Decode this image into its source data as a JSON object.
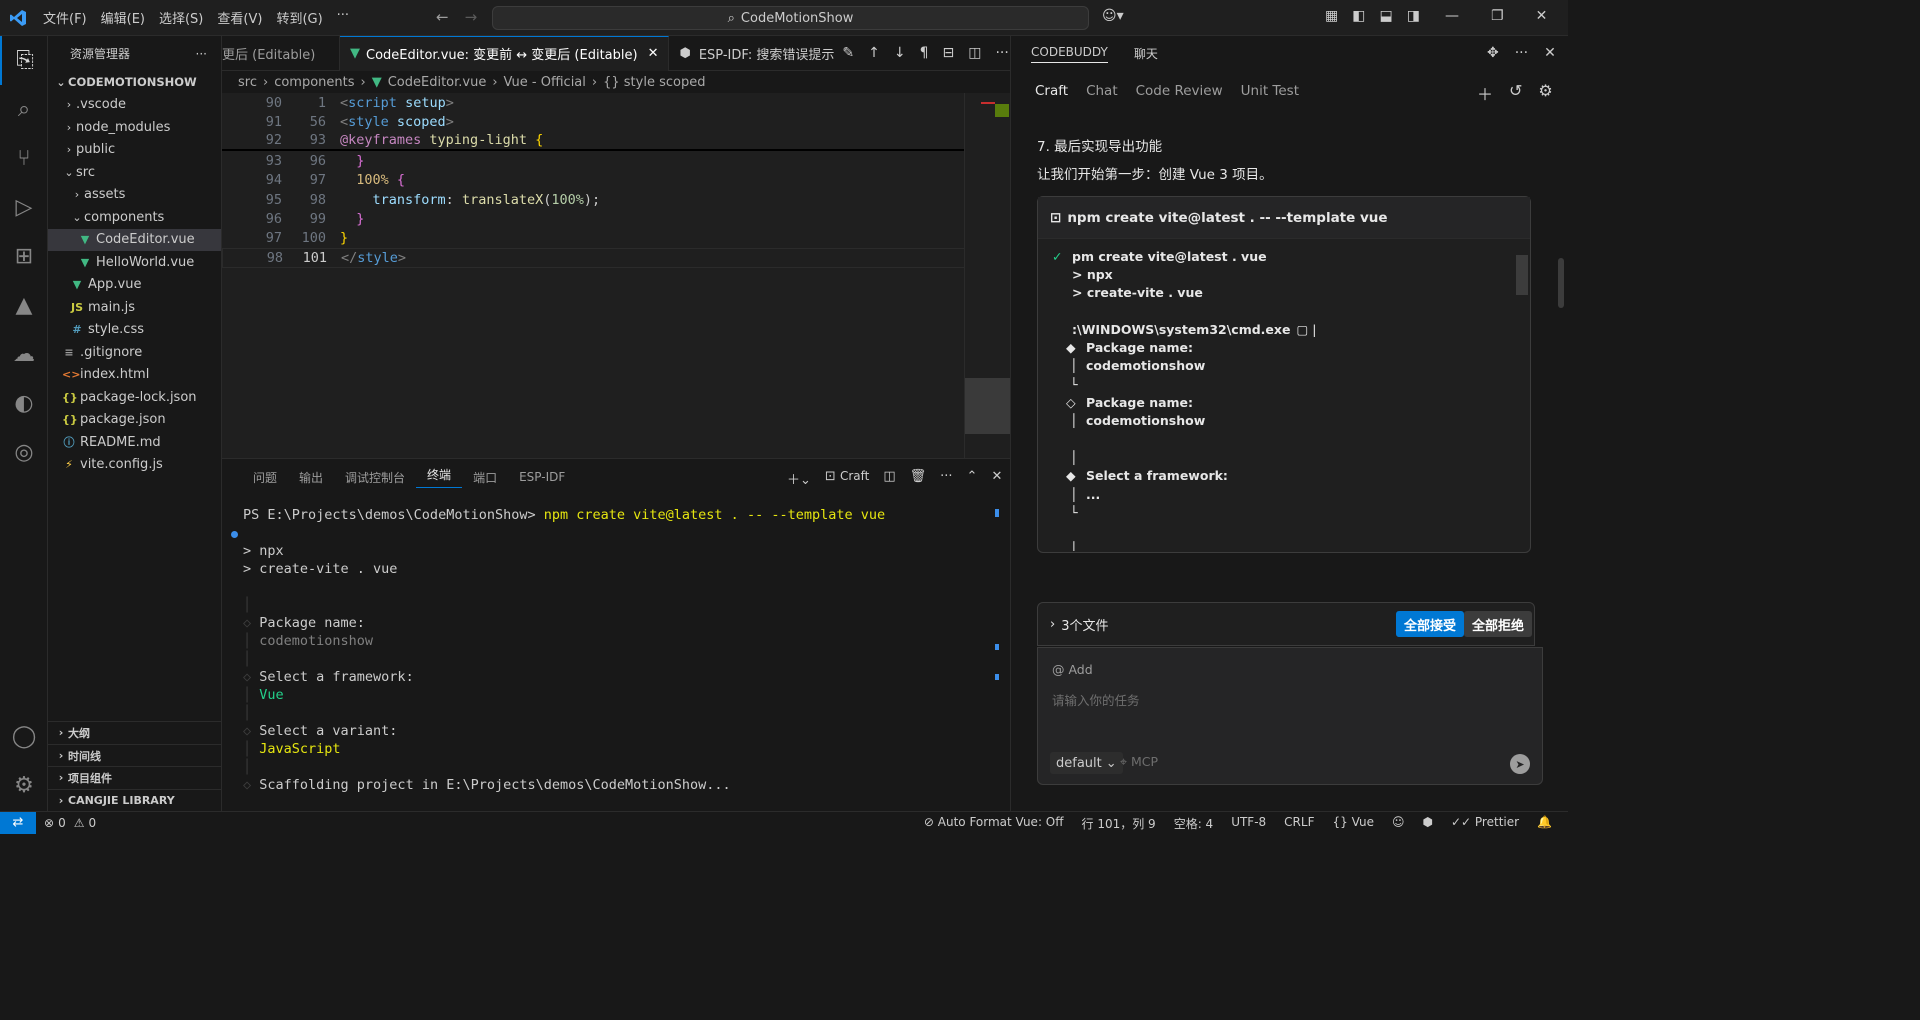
{
  "titlebar": {
    "menu": [
      "文件(F)",
      "编辑(E)",
      "选择(S)",
      "查看(V)",
      "转到(G)",
      "···"
    ],
    "search": "CodeMotionShow"
  },
  "sidebar": {
    "title": "资源管理器",
    "project": "CODEMOTIONSHOW",
    "items": [
      {
        "label": ".vscode",
        "type": "folder",
        "depth": 1
      },
      {
        "label": "node_modules",
        "type": "folder",
        "depth": 1
      },
      {
        "label": "public",
        "type": "folder",
        "depth": 1
      },
      {
        "label": "src",
        "type": "folder-open",
        "depth": 1
      },
      {
        "label": "assets",
        "type": "folder",
        "depth": 2
      },
      {
        "label": "components",
        "type": "folder-open",
        "depth": 2
      },
      {
        "label": "CodeEditor.vue",
        "type": "vue",
        "depth": 3
      },
      {
        "label": "HelloWorld.vue",
        "type": "vue",
        "depth": 3
      },
      {
        "label": "App.vue",
        "type": "vue",
        "depth": 2
      },
      {
        "label": "main.js",
        "type": "js",
        "depth": 2
      },
      {
        "label": "style.css",
        "type": "css",
        "depth": 2
      },
      {
        "label": ".gitignore",
        "type": "text",
        "depth": 1
      },
      {
        "label": "index.html",
        "type": "html",
        "depth": 1
      },
      {
        "label": "package-lock.json",
        "type": "json",
        "depth": 1
      },
      {
        "label": "package.json",
        "type": "json",
        "depth": 1
      },
      {
        "label": "README.md",
        "type": "info",
        "depth": 1
      },
      {
        "label": "vite.config.js",
        "type": "vite",
        "depth": 1
      }
    ],
    "sections": [
      "大纲",
      "时间线",
      "项目组件",
      "CANGJIE LIBRARY"
    ]
  },
  "tabs": {
    "prev": "更后 (Editable)",
    "active": "CodeEditor.vue: 变更前 ↔ 变更后 (Editable)",
    "next": "ESP-IDF: 搜索错误提示"
  },
  "breadcrumb": [
    "src",
    "components",
    "CodeEditor.vue",
    "Vue - Official",
    "{} style scoped"
  ],
  "editor": {
    "lines": [
      {
        "l": "90",
        "r": "1"
      },
      {
        "l": "91",
        "r": "56"
      },
      {
        "l": "92",
        "r": "93"
      },
      {
        "l": "93",
        "r": "96"
      },
      {
        "l": "94",
        "r": "97"
      },
      {
        "l": "95",
        "r": "98"
      },
      {
        "l": "96",
        "r": "99"
      },
      {
        "l": "97",
        "r": "100"
      },
      {
        "l": "98",
        "r": "101"
      }
    ]
  },
  "panel": {
    "tabs": [
      "问题",
      "输出",
      "调试控制台",
      "终端",
      "端口",
      "ESP-IDF"
    ],
    "craft": "Craft",
    "prompt": "PS E:\\Projects\\demos\\CodeMotionShow>",
    "command": "npm create vite@latest . -- --template vue",
    "out1": "> npx",
    "out2": "> create-vite . vue",
    "q1": "Package name:",
    "a1": "codemotionshow",
    "q2": "Select a framework:",
    "a2": "Vue",
    "q3": "Select a variant:",
    "a3": "JavaScript",
    "q4": "Scaffolding project in E:\\Projects\\demos\\CodeMotionShow..."
  },
  "chat": {
    "header": "CODEBUDDY",
    "header2": "聊天",
    "tabs": [
      "Craft",
      "Chat",
      "Code Review",
      "Unit Test"
    ],
    "msg1": "7. 最后实现导出功能",
    "msg2": "让我们开始第一步：创建 Vue 3 项目。",
    "card_title": "npm create vite@latest . -- --template vue",
    "card_lines": [
      "pm create vite@latest . vue",
      "> npx",
      "> create-vite . vue",
      "",
      ":\\WINDOWS\\system32\\cmd.exe",
      "Package name:",
      "codemotionshow",
      "",
      "Package name:",
      "codemotionshow",
      "",
      "",
      "Select a framework:",
      "...",
      "",
      ""
    ],
    "files": "3个文件",
    "accept": "全部接受",
    "reject": "全部拒绝",
    "add": "@ Add",
    "placeholder": "请输入你的任务",
    "model": "default",
    "mcp": "MCP"
  },
  "status": {
    "errors": "0",
    "warnings": "0",
    "format": "Auto Format Vue: Off",
    "pos": "行 101，列 9",
    "spaces": "空格: 4",
    "enc": "UTF-8",
    "eol": "CRLF",
    "lang": "Vue",
    "prettier": "Prettier"
  }
}
